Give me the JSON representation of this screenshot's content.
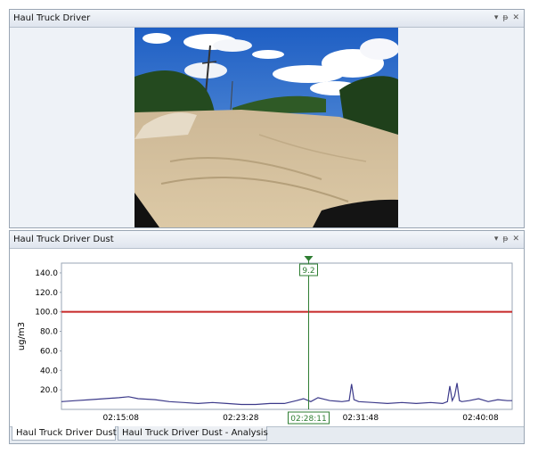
{
  "video_pane": {
    "title": "Haul Truck Driver",
    "controls": [
      "▾",
      "ᵽ",
      "✕"
    ]
  },
  "chart_pane": {
    "title": "Haul Truck Driver Dust",
    "controls": [
      "▾",
      "ᵽ",
      "✕"
    ],
    "tabs": [
      {
        "label": "Haul Truck Driver Dust",
        "active": true
      },
      {
        "label": "Haul Truck Driver Dust - Analysis",
        "active": false
      }
    ]
  },
  "icons": {
    "dropdown": "chevron-down-icon",
    "pin": "pin-icon",
    "close": "close-icon",
    "cursor_marker": "triangle-down-icon"
  },
  "colors": {
    "series": "#3c3a8a",
    "threshold": "#c62828",
    "cursor": "#2e7d32"
  },
  "chart_data": {
    "type": "line",
    "ylabel": "ug/m3",
    "ylim": [
      0,
      150
    ],
    "yticks": [
      20.0,
      40.0,
      60.0,
      80.0,
      100.0,
      120.0,
      140.0
    ],
    "ytick_labels": [
      "20.0",
      "40.0",
      "60.0",
      "80.0",
      "100.0",
      "120.0",
      "140.0"
    ],
    "xticks": [
      "02:15:08",
      "02:23:28",
      "02:31:48",
      "02:40:08"
    ],
    "xlim": [
      "02:11:00",
      "02:42:20"
    ],
    "threshold": 100.0,
    "cursor": {
      "time": "02:28:11",
      "value": "9.2"
    },
    "series": [
      {
        "x": [
          "02:11:00",
          "02:12:00",
          "02:13:00",
          "02:14:00",
          "02:15:00",
          "02:15:40",
          "02:16:20",
          "02:17:30",
          "02:18:30",
          "02:19:30",
          "02:20:30",
          "02:21:30",
          "02:22:30",
          "02:23:30",
          "02:24:30",
          "02:25:30",
          "02:26:30",
          "02:27:20",
          "02:27:50",
          "02:28:20",
          "02:28:50",
          "02:29:40",
          "02:30:30",
          "02:31:00",
          "02:31:10",
          "02:31:20",
          "02:31:40",
          "02:32:40",
          "02:33:40",
          "02:34:40",
          "02:35:40",
          "02:36:40",
          "02:37:30",
          "02:37:50",
          "02:38:00",
          "02:38:10",
          "02:38:20",
          "02:38:30",
          "02:38:40",
          "02:38:50",
          "02:39:20",
          "02:40:00",
          "02:40:40",
          "02:41:20",
          "02:42:00",
          "02:42:20"
        ],
        "values": [
          8,
          9,
          10,
          11,
          12,
          13,
          11,
          10,
          8,
          7,
          6,
          7,
          6,
          5,
          5,
          6,
          6,
          9,
          11,
          8,
          12,
          9,
          8,
          9,
          26,
          10,
          8,
          7,
          6,
          7,
          6,
          7,
          6,
          8,
          24,
          9,
          14,
          27,
          9,
          8,
          9,
          11,
          8,
          10,
          9,
          9
        ]
      }
    ]
  }
}
